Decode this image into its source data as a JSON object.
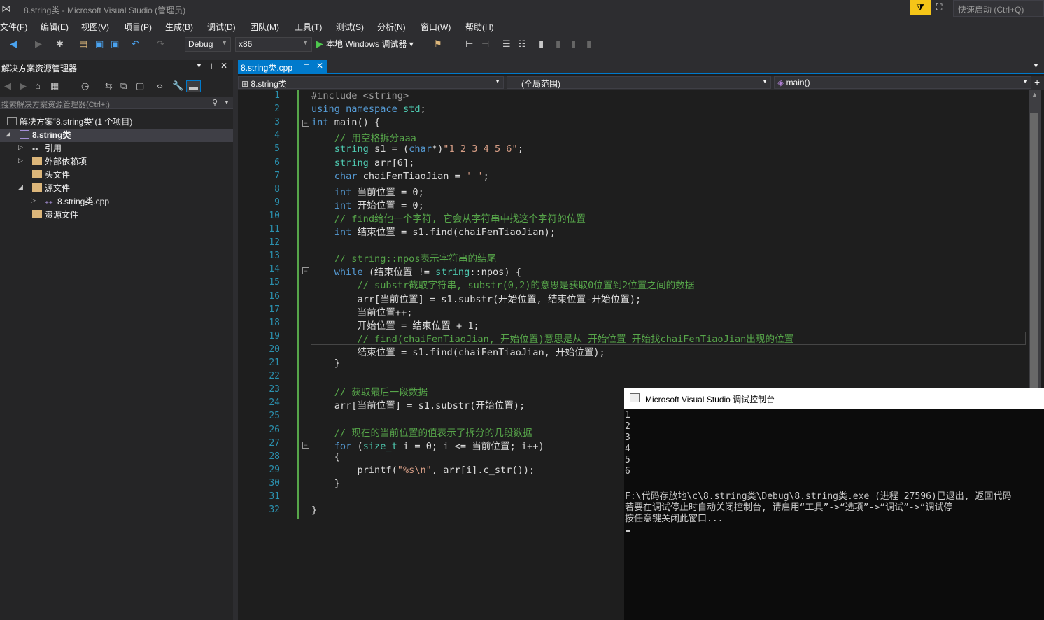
{
  "window": {
    "title": "8.string类 - Microsoft Visual Studio (管理员)",
    "quick_launch": "快速启动 (Ctrl+Q)"
  },
  "menus": [
    "文件(F)",
    "编辑(E)",
    "视图(V)",
    "项目(P)",
    "生成(B)",
    "调试(D)",
    "团队(M)",
    "工具(T)",
    "测试(S)",
    "分析(N)",
    "窗口(W)",
    "帮助(H)"
  ],
  "toolbar": {
    "config": "Debug",
    "platform": "x86",
    "run_label": "本地 Windows 调试器"
  },
  "solution_explorer": {
    "title": "解决方案资源管理器",
    "search_placeholder": "搜索解决方案资源管理器(Ctrl+;)",
    "solution": "解决方案“8.string类”(1 个项目)",
    "project": "8.string类",
    "items": [
      "引用",
      "外部依赖项",
      "头文件",
      "源文件",
      "8.string类.cpp",
      "资源文件"
    ]
  },
  "editor": {
    "tab": "8.string类.cpp",
    "nav_project": "8.string类",
    "nav_scope": "(全局范围)",
    "nav_member": "main()"
  },
  "code_lines": [
    "#include <string>",
    "using namespace std;",
    "int main() {",
    "    // 用空格拆分aaa",
    "    string s1 = (char*)\"1 2 3 4 5 6\";",
    "    string arr[6];",
    "    char chaiFenTiaoJian = ' ';",
    "    int 当前位置 = 0;",
    "    int 开始位置 = 0;",
    "    // find给他一个字符, 它会从字符串中找这个字符的位置",
    "    int 结束位置 = s1.find(chaiFenTiaoJian);",
    "",
    "    // string::npos表示字符串的结尾",
    "    while (结束位置 != string::npos) {",
    "        // substr截取字符串, substr(0,2)的意思是获取0位置到2位置之间的数据",
    "        arr[当前位置] = s1.substr(开始位置, 结束位置-开始位置);",
    "        当前位置++;",
    "        开始位置 = 结束位置 + 1;",
    "        // find(chaiFenTiaoJian, 开始位置)意思是从 开始位置 开始找chaiFenTiaoJian出现的位置",
    "        结束位置 = s1.find(chaiFenTiaoJian, 开始位置);",
    "    }",
    "",
    "    // 获取最后一段数据",
    "    arr[当前位置] = s1.substr(开始位置);",
    "",
    "    // 现在的当前位置的值表示了拆分的几段数据",
    "    for (size_t i = 0; i <= 当前位置; i++)",
    "    {",
    "        printf(\"%s\\n\", arr[i].c_str());",
    "    }",
    "",
    "}"
  ],
  "console": {
    "title": "Microsoft Visual Studio 调试控制台",
    "lines": [
      "1",
      "2",
      "3",
      "4",
      "5",
      "6",
      "",
      "F:\\代码存放地\\c\\8.string类\\Debug\\8.string类.exe (进程 27596)已退出, 返回代码",
      "若要在调试停止时自动关闭控制台, 请启用“工具”->“选项”->“调试”->“调试停",
      "按任意键关闭此窗口..."
    ]
  }
}
